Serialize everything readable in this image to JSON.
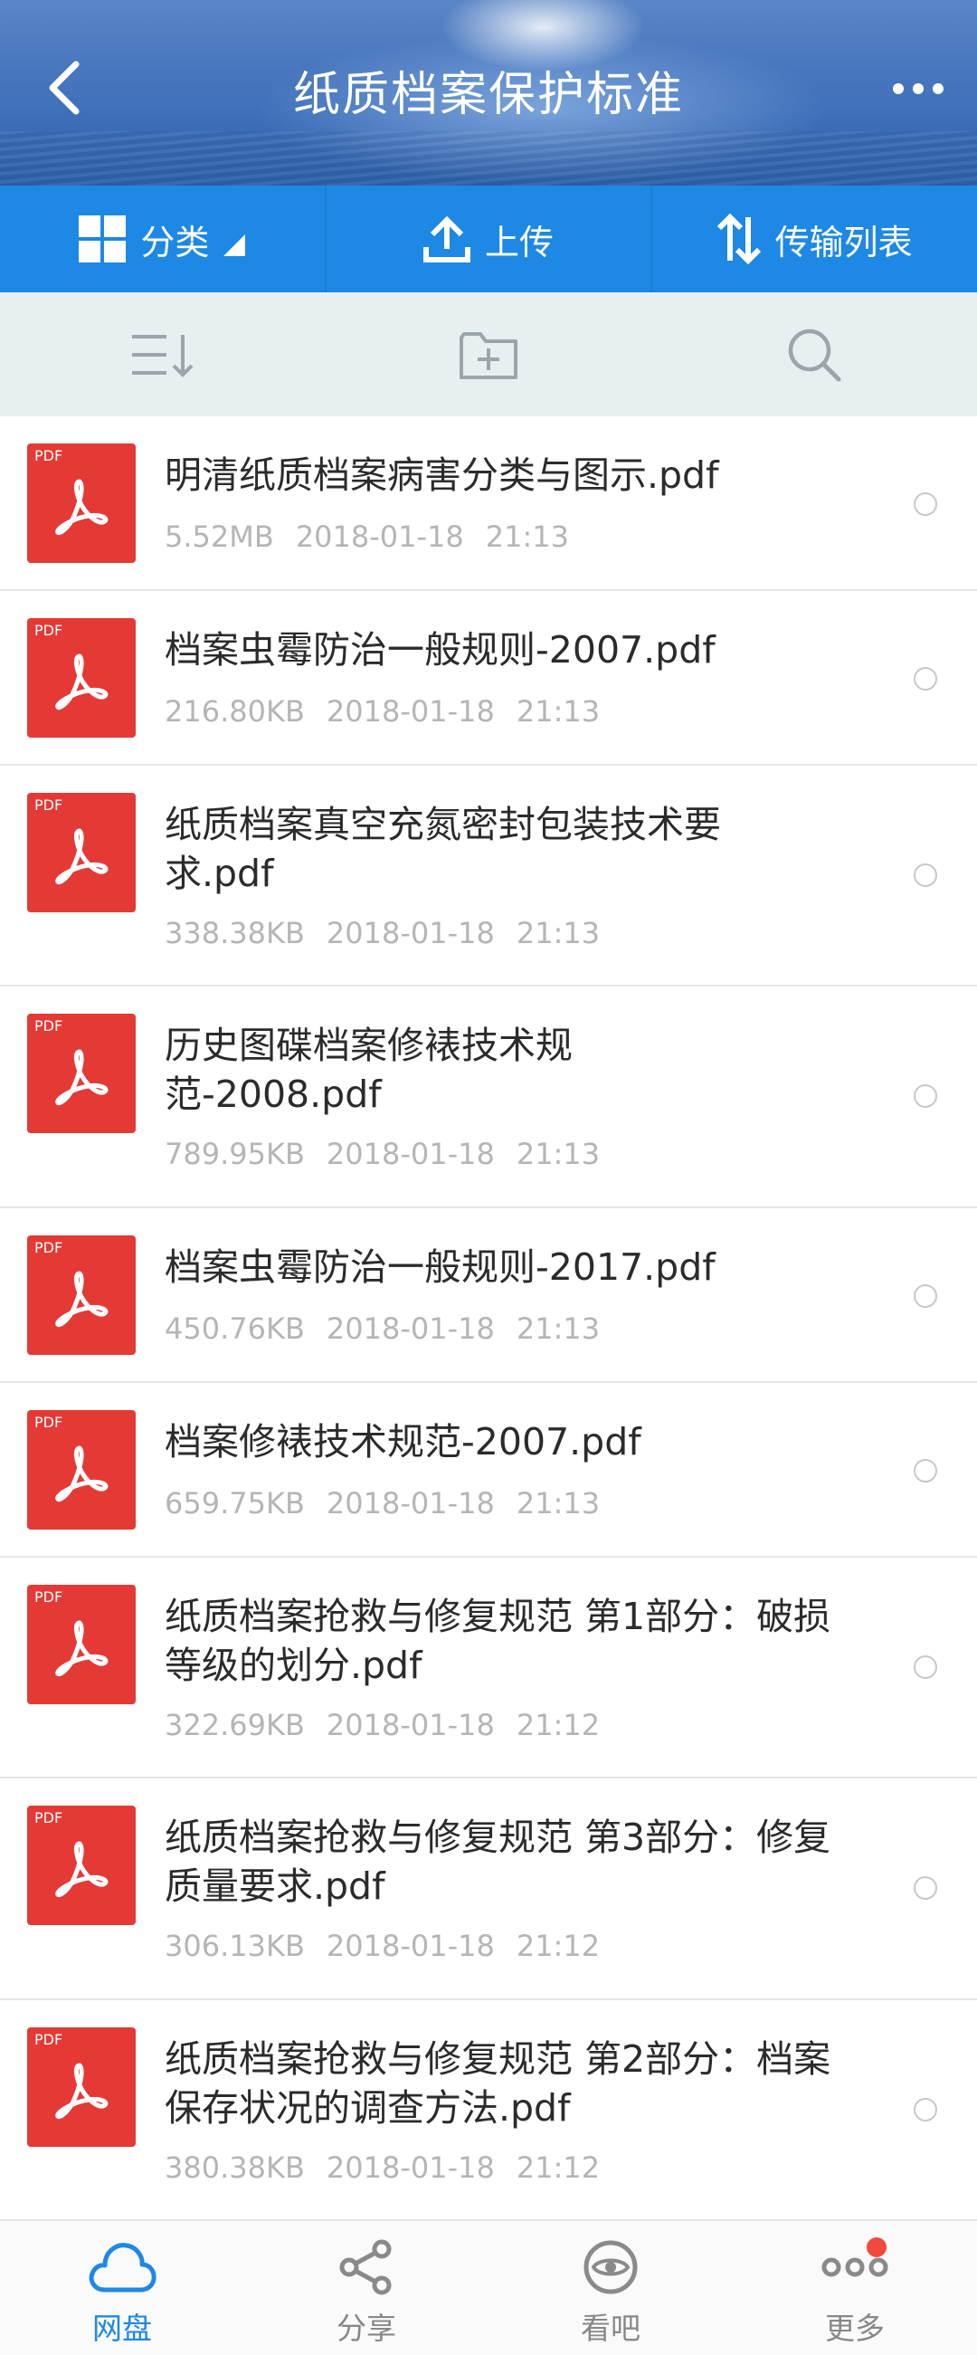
{
  "header": {
    "title": "纸质档案保护标准"
  },
  "toolbar": {
    "category_label": "分类",
    "upload_label": "上传",
    "transfer_label": "传输列表"
  },
  "icons": {
    "back": "back-arrow-icon",
    "more": "more-dots-icon",
    "category": "grid-icon",
    "upload": "upload-icon",
    "transfer": "transfer-arrows-icon",
    "sort": "sort-list-icon",
    "new_folder": "add-folder-icon",
    "search": "search-icon",
    "file": "pdf-icon"
  },
  "colors": {
    "accent": "#1e88e5",
    "pdf": "#e53935",
    "badge": "#f04a3c"
  },
  "files": [
    {
      "name": "明清纸质档案病害分类与图示.pdf",
      "size": "5.52MB",
      "date": "2018-01-18",
      "time": "21:13"
    },
    {
      "name": "档案虫霉防治一般规则-2007.pdf",
      "size": "216.80KB",
      "date": "2018-01-18",
      "time": "21:13"
    },
    {
      "name": "纸质档案真空充氮密封包装技术要求.pdf",
      "size": "338.38KB",
      "date": "2018-01-18",
      "time": "21:13"
    },
    {
      "name": "历史图碟档案修裱技术规范-2008.pdf",
      "size": "789.95KB",
      "date": "2018-01-18",
      "time": "21:13"
    },
    {
      "name": "档案虫霉防治一般规则-2017.pdf",
      "size": "450.76KB",
      "date": "2018-01-18",
      "time": "21:13"
    },
    {
      "name": "档案修裱技术规范-2007.pdf",
      "size": "659.75KB",
      "date": "2018-01-18",
      "time": "21:13"
    },
    {
      "name": "纸质档案抢救与修复规范 第1部分：破损等级的划分.pdf",
      "size": "322.69KB",
      "date": "2018-01-18",
      "time": "21:12"
    },
    {
      "name": "纸质档案抢救与修复规范 第3部分：修复质量要求.pdf",
      "size": "306.13KB",
      "date": "2018-01-18",
      "time": "21:12"
    },
    {
      "name": "纸质档案抢救与修复规范 第2部分：档案保存状况的调查方法.pdf",
      "size": "380.38KB",
      "date": "2018-01-18",
      "time": "21:12"
    }
  ],
  "file_tag": "PDF",
  "nav": {
    "items": [
      {
        "label": "网盘",
        "icon": "cloud-icon",
        "active": true
      },
      {
        "label": "分享",
        "icon": "share-icon",
        "active": false
      },
      {
        "label": "看吧",
        "icon": "eye-icon",
        "active": false
      },
      {
        "label": "更多",
        "icon": "more-circles-icon",
        "active": false
      }
    ]
  }
}
